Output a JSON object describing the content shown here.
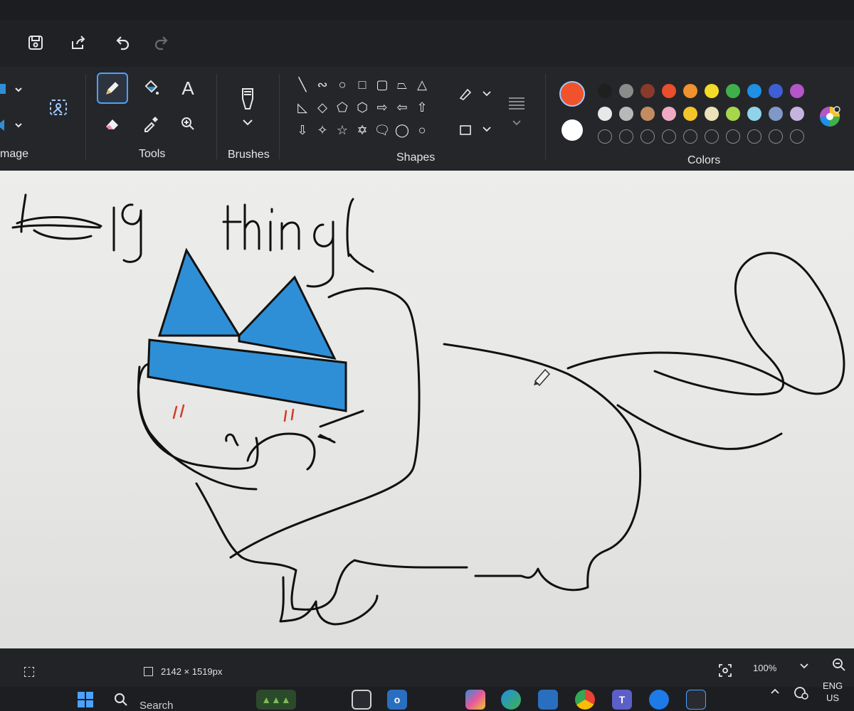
{
  "ribbon": {
    "image_label": "mage",
    "tools_label": "Tools",
    "brushes_label": "Brushes",
    "shapes_label": "Shapes",
    "colors_label": "Colors",
    "text_tool_glyph": "A"
  },
  "colors": {
    "primary": "#f0532c",
    "secondary": "#ffffff",
    "palette_row1": [
      "#1f1f1f",
      "#8b8b8b",
      "#8a3a2a",
      "#ea4e2a",
      "#f0922f",
      "#f3dc27",
      "#3fb14b",
      "#1e90e6",
      "#3f5fd6",
      "#b455c8"
    ],
    "palette_row2": [
      "#e8e8e8",
      "#b8b8b8",
      "#c38b62",
      "#f0a9c4",
      "#f3c52a",
      "#ece1b8",
      "#a6d64a",
      "#8fd3ea",
      "#7f98c8",
      "#c5b3e0"
    ]
  },
  "status": {
    "canvas_size": "2142 × 1519px",
    "zoom": "100%"
  },
  "taskbar": {
    "search_placeholder": "Search",
    "lang_top": "ENG",
    "lang_bottom": "US"
  },
  "drawing": {
    "text_big": "Big",
    "text_thing": "thing",
    "hat_color": "#2f8fd6",
    "line_color": "#111111",
    "blush_color": "#d23a2a"
  }
}
